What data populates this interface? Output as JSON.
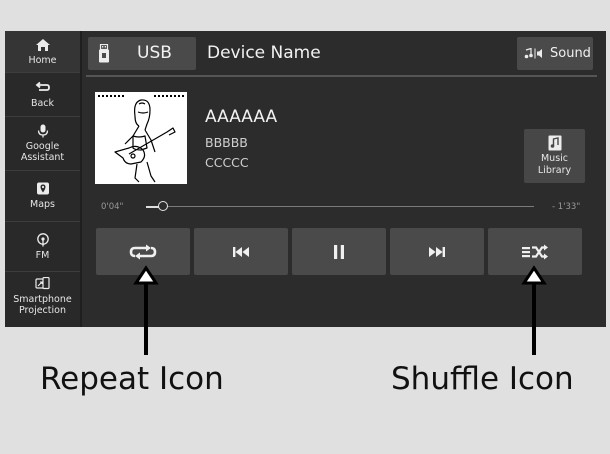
{
  "sidebar": {
    "items": [
      {
        "label": "Home",
        "icon": "home-icon"
      },
      {
        "label": "Back",
        "icon": "back-icon"
      },
      {
        "label": "Google Assistant",
        "icon": "microphone-icon"
      },
      {
        "label": "Maps",
        "icon": "map-pin-icon"
      },
      {
        "label": "FM",
        "icon": "radio-icon"
      },
      {
        "label": "Smartphone Projection",
        "icon": "smartphone-projection-icon"
      }
    ]
  },
  "header": {
    "source_label": "USB",
    "source_icon": "usb-icon",
    "device_name": "Device Name",
    "sound_label": "Sound",
    "sound_icon": "sound-icon"
  },
  "track": {
    "title": "AAAAAA",
    "artist": "BBBBB",
    "album": "CCCCC",
    "album_art_icon": "album-art-guitarist-icon"
  },
  "music_library": {
    "label_line1": "Music",
    "label_line2": "Library",
    "icon": "music-note-icon"
  },
  "progress": {
    "elapsed": "0'04\"",
    "remaining": "- 1'33\"",
    "fraction": 0.043
  },
  "controls": [
    {
      "name": "repeat",
      "icon": "repeat-icon"
    },
    {
      "name": "previous",
      "icon": "skip-previous-icon"
    },
    {
      "name": "pause",
      "icon": "pause-icon"
    },
    {
      "name": "next",
      "icon": "skip-next-icon"
    },
    {
      "name": "shuffle",
      "icon": "shuffle-icon"
    }
  ],
  "callouts": {
    "repeat_label": "Repeat Icon",
    "shuffle_label": "Shuffle Icon"
  },
  "colors": {
    "screen_bg": "#2c2c2c",
    "button_bg": "#4a4a4a",
    "page_bg": "#e0e0e0"
  }
}
